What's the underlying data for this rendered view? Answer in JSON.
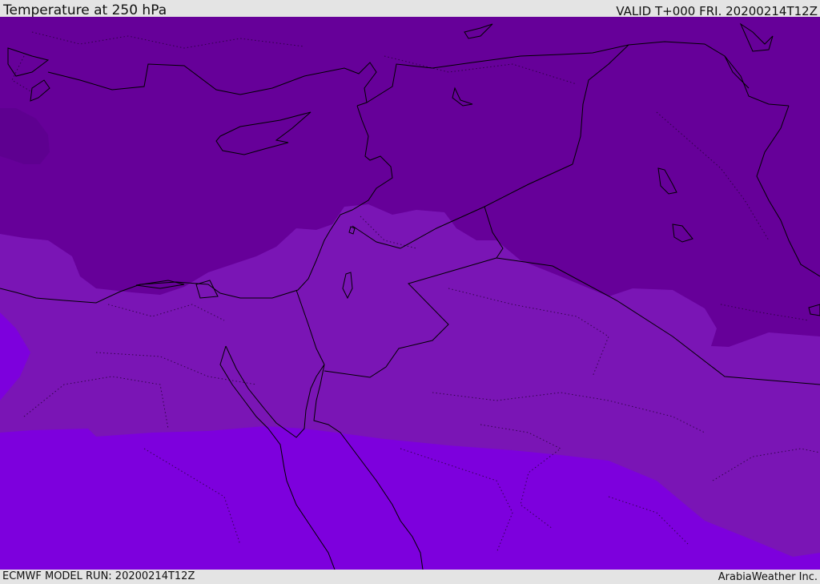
{
  "header": {
    "title": "Temperature at 250 hPa",
    "valid": "VALID T+000 FRI. 20200214T12Z"
  },
  "footer": {
    "model_run": "ECMWF MODEL RUN: 20200214T12Z",
    "credit": "ArabiaWeather Inc."
  },
  "map": {
    "colors": {
      "coldest_band": "#5e0090",
      "cold_band": "#660099",
      "mid_band": "#7a15b5",
      "warm_band": "#7d00dd",
      "boundary_lines": "#000000"
    }
  }
}
